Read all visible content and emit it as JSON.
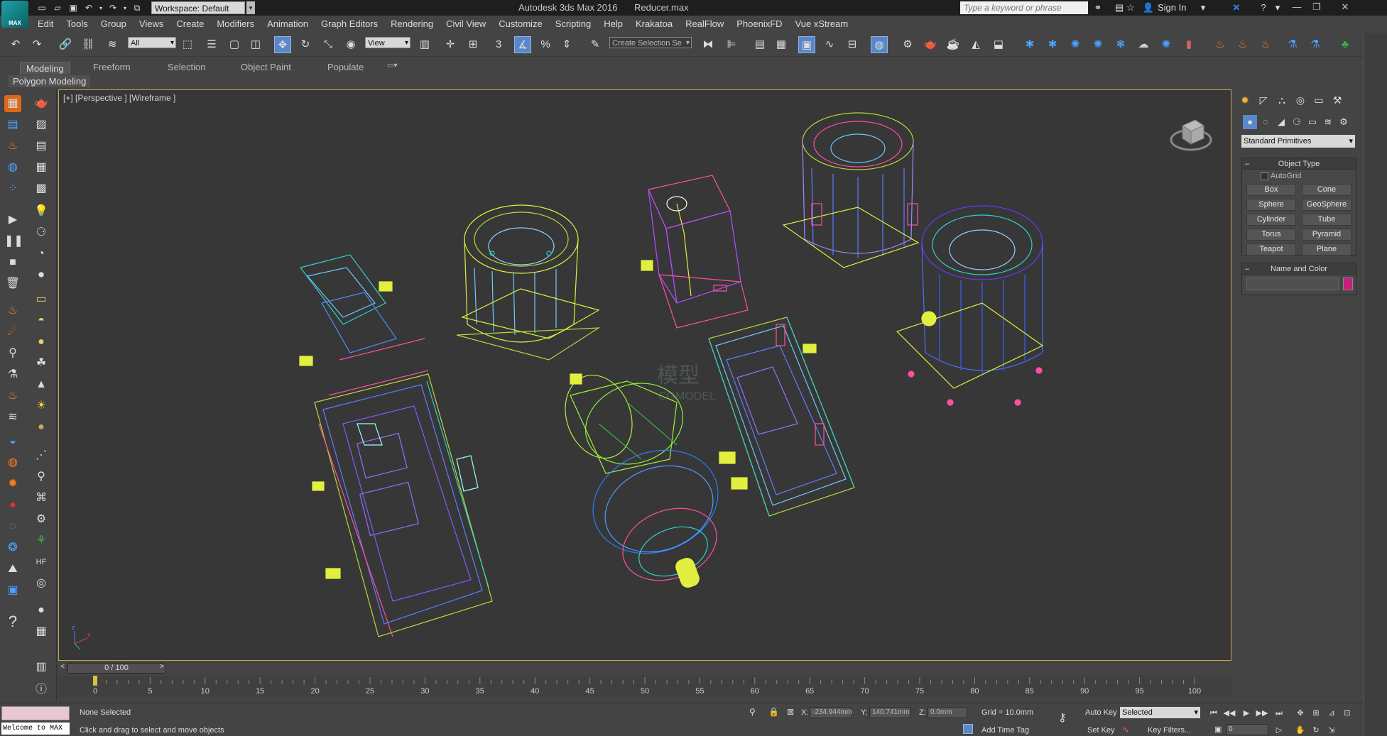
{
  "titlebar": {
    "logo_text": "MAX",
    "workspace": "Workspace: Default",
    "app_title": "Autodesk 3ds Max 2016",
    "file_name": "Reducer.max",
    "search_placeholder": "Type a keyword or phrase",
    "signin": "Sign In",
    "window_buttons": [
      "—",
      "❐",
      "✕"
    ]
  },
  "menu": [
    "Edit",
    "Tools",
    "Group",
    "Views",
    "Create",
    "Modifiers",
    "Animation",
    "Graph Editors",
    "Rendering",
    "Civil View",
    "Customize",
    "Scripting",
    "Help",
    "Krakatoa",
    "RealFlow",
    "PhoenixFD",
    "Vue xStream"
  ],
  "toolbar": {
    "filter_select": "All",
    "refcoord_select": "View",
    "selection_set": "Create Selection Se"
  },
  "ribbon": {
    "tabs": [
      "Modeling",
      "Freeform",
      "Selection",
      "Object Paint",
      "Populate"
    ],
    "active_tab": "Modeling",
    "subtitle": "Polygon Modeling"
  },
  "viewport": {
    "label": "[+] [Perspective ] [Wireframe ]",
    "watermark_cn": "模型",
    "watermark_en": "CGMODEL",
    "axis_x": "x",
    "axis_z": "z"
  },
  "command_panel": {
    "primitive_dropdown": "Standard Primitives",
    "object_type_title": "Object Type",
    "autogrid": "AutoGrid",
    "primitives": [
      "Box",
      "Cone",
      "Sphere",
      "GeoSphere",
      "Cylinder",
      "Tube",
      "Torus",
      "Pyramid",
      "Teapot",
      "Plane"
    ],
    "name_color_title": "Name and Color",
    "object_color": "#c71f7d"
  },
  "timeline": {
    "slider_text": "0 / 100",
    "ticks": [
      0,
      5,
      10,
      15,
      20,
      25,
      30,
      35,
      40,
      45,
      50,
      55,
      60,
      65,
      70,
      75,
      80,
      85,
      90,
      95,
      100
    ]
  },
  "status": {
    "welcome": "Welcome to MAX",
    "selection": "None Selected",
    "prompt": "Click and drag to select and move objects",
    "x_label": "X:",
    "x_value": "-234.944mm",
    "y_label": "Y:",
    "y_value": "140.741mm",
    "z_label": "Z:",
    "z_value": "0.0mm",
    "grid": "Grid = 10.0mm",
    "add_time_tag": "Add Time Tag",
    "auto_key": "Auto Key",
    "set_key": "Set Key",
    "selected_dd": "Selected",
    "key_filters": "Key Filters...",
    "frame": "0"
  },
  "colors": {
    "viewport_border": "#c9a94c",
    "active_button": "#5a87c9"
  }
}
